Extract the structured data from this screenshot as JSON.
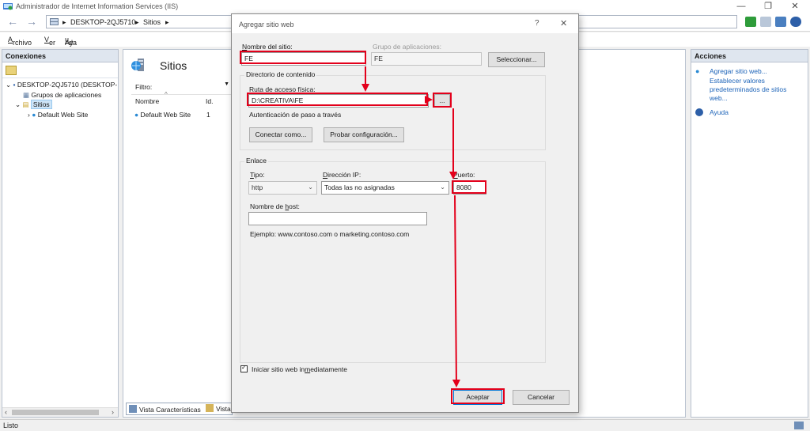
{
  "window": {
    "title": "Administrador de Internet Information Services (IIS)",
    "controls": [
      "—",
      "❐",
      "✕"
    ]
  },
  "address": {
    "back": "←",
    "forward": "→",
    "crumbs": [
      "DESKTOP-2QJ5710",
      "Sitios"
    ],
    "separator": "▸"
  },
  "menu": {
    "items": [
      {
        "pre": "",
        "key": "A",
        "post": "rchivo"
      },
      {
        "pre": "",
        "key": "V",
        "post": "er"
      },
      {
        "pre": "Ay",
        "key": "u",
        "post": "da"
      }
    ]
  },
  "connections": {
    "header": "Conexiones",
    "tree": {
      "server": "DESKTOP-2QJ5710 (DESKTOP-",
      "app_pools": "Grupos de aplicaciones",
      "sites": "Sitios",
      "default_site": "Default Web Site"
    }
  },
  "center": {
    "title": "Sitios",
    "filter_label": "Filtro:",
    "columns": [
      "Nombre",
      "Id."
    ],
    "rows": [
      {
        "name": "Default Web Site",
        "id": "1"
      }
    ],
    "bottom_tabs": [
      "Vista Características",
      "Vista"
    ]
  },
  "actions": {
    "header": "Acciones",
    "items": [
      {
        "label": "Agregar sitio web..."
      },
      {
        "label": "Establecer valores predeterminados de sitios web..."
      }
    ],
    "help": "Ayuda"
  },
  "status": {
    "text": "Listo"
  },
  "dialog": {
    "title": "Agregar sitio web",
    "help_btn": "?",
    "close_btn": "✕",
    "site_name_label": "Nombre del sitio:",
    "site_name_value": "FE",
    "app_pool_label": "Grupo de aplicaciones:",
    "app_pool_value": "FE",
    "select_btn": "Seleccionar...",
    "content_group_label": "Directorio de contenido",
    "physical_path_label": "Ruta de acceso física:",
    "physical_path_value": "D:\\CREATIVA\\FE",
    "browse_btn": "...",
    "passthrough_label": "Autenticación de paso a través",
    "connect_as_btn": "Conectar como...",
    "test_settings_btn": "Probar configuración...",
    "binding_group_label": "Enlace",
    "type_label": "Tipo:",
    "type_value": "http",
    "ip_label": "Dirección IP:",
    "ip_value": "Todas las no asignadas",
    "port_label": "Puerto:",
    "port_value": "8080",
    "hostname_label": "Nombre de host:",
    "hostname_value": "",
    "example_text": "Ejemplo: www.contoso.com o marketing.contoso.com",
    "start_checkbox_label": "Iniciar sitio web inmediatamente",
    "start_checked": true,
    "ok_btn": "Aceptar",
    "cancel_btn": "Cancelar"
  },
  "colors": {
    "annotation_red": "#e3001b",
    "link_blue": "#1c63b8",
    "panel_header": "#dfe6ef"
  }
}
